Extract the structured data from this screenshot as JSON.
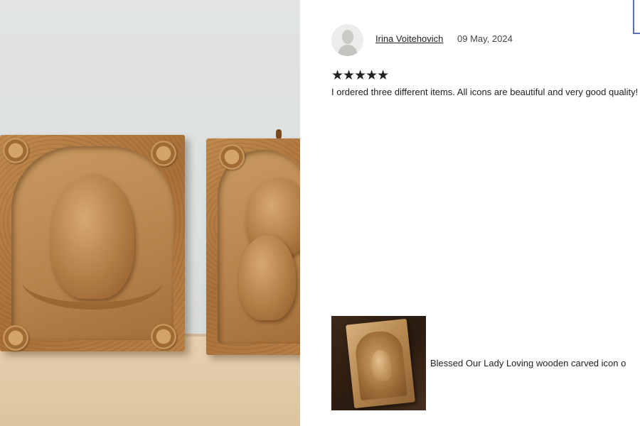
{
  "review": {
    "reviewer_name": "Irina Voitehovich",
    "date": "09 May, 2024",
    "rating": 5,
    "stars_text": "★★★★★",
    "text": "I ordered three different items. All icons are beautiful and very good quality!"
  },
  "purchased_item": {
    "title": "Blessed Our Lady Loving wooden carved icon o"
  },
  "icons": {
    "avatar": "user-avatar-icon",
    "stars": "star-icon"
  }
}
